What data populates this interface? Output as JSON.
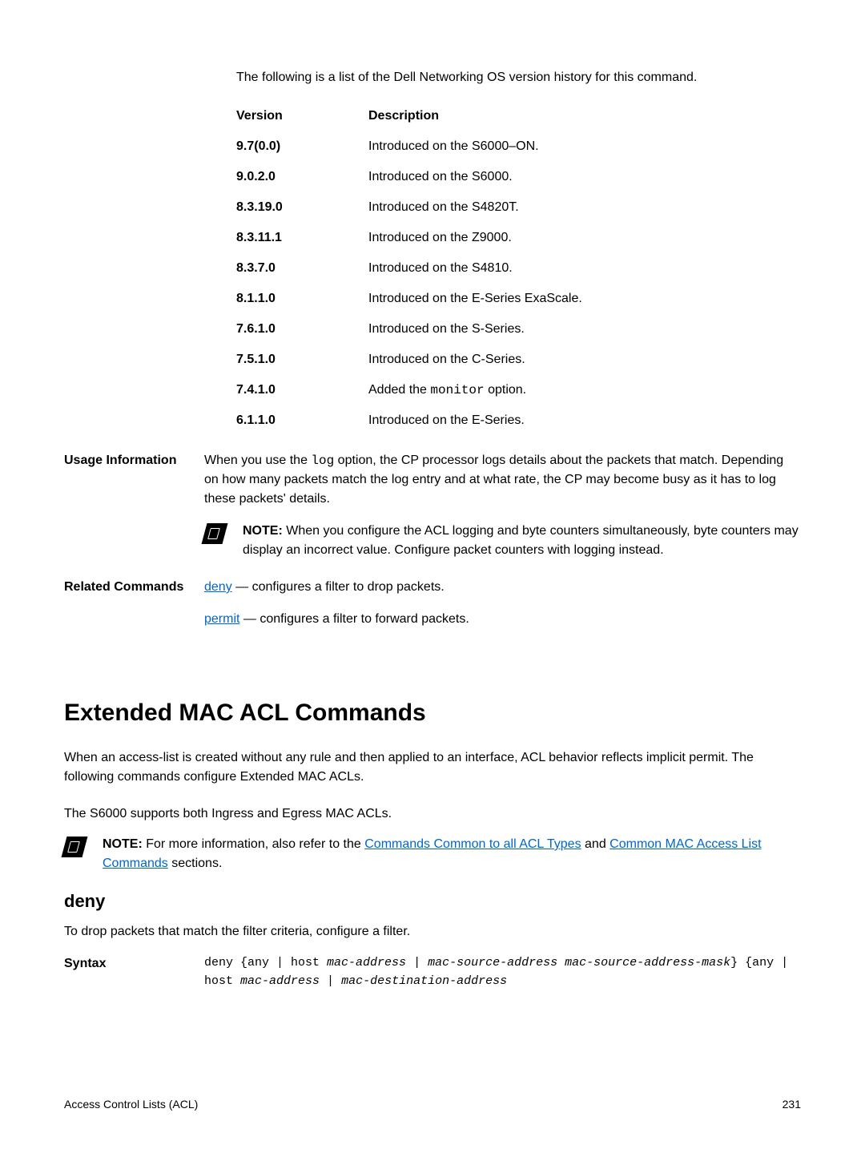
{
  "intro": "The following is a list of the Dell Networking OS version history for this command.",
  "headers": {
    "version": "Version",
    "description": "Description"
  },
  "versions": [
    {
      "v": "9.7(0.0)",
      "d": "Introduced on the S6000–ON."
    },
    {
      "v": "9.0.2.0",
      "d": "Introduced on the S6000."
    },
    {
      "v": "8.3.19.0",
      "d": "Introduced on the S4820T."
    },
    {
      "v": "8.3.11.1",
      "d": "Introduced on the Z9000."
    },
    {
      "v": "8.3.7.0",
      "d": "Introduced on the S4810."
    },
    {
      "v": "8.1.1.0",
      "d": "Introduced on the E-Series ExaScale."
    },
    {
      "v": "7.6.1.0",
      "d": "Introduced on the S-Series."
    },
    {
      "v": "7.5.1.0",
      "d": "Introduced on the C-Series."
    }
  ],
  "version_monitor": {
    "v": "7.4.1.0",
    "d_pre": "Added the ",
    "d_mono": "monitor",
    "d_post": " option."
  },
  "version_last": {
    "v": "6.1.1.0",
    "d": "Introduced on the E-Series."
  },
  "usage": {
    "label": "Usage Information",
    "text_pre": "When you use the ",
    "text_mono": "log",
    "text_post": " option, the CP processor logs details about the packets that match. Depending on how many packets match the log entry and at what rate, the CP may become busy as it has to log these packets' details.",
    "note_label": "NOTE:",
    "note_text": " When you configure the ACL logging and byte counters simultaneously, byte counters may display an incorrect value. Configure packet counters with logging instead."
  },
  "related": {
    "label": "Related Commands",
    "deny_link": "deny",
    "deny_text": " — configures a filter to drop packets.",
    "permit_link": "permit",
    "permit_text": " — configures a filter to forward packets."
  },
  "h1": "Extended MAC ACL Commands",
  "h1_desc": "When an access-list is created without any rule and then applied to an interface, ACL behavior reflects implicit permit. The following commands configure Extended MAC ACLs.",
  "s6000": "The S6000 supports both Ingress and Egress MAC ACLs.",
  "note2": {
    "label": "NOTE:",
    "text_pre": " For more information, also refer to the ",
    "link1": "Commands Common to all ACL Types",
    "text_mid": " and ",
    "link2": "Common MAC Access List Commands",
    "text_post": " sections."
  },
  "h2": "deny",
  "deny_desc": "To drop packets that match the filter criteria, configure a filter.",
  "syntax": {
    "label": "Syntax",
    "p1": "deny {any | host ",
    "i1": "mac-address",
    "p2": " | ",
    "i2": "mac-source-address",
    "p3": " ",
    "i3": "mac-source-address-mask",
    "p4": "} {any | host ",
    "i4": "mac-address",
    "p5": " | ",
    "i5": "mac-destination-address"
  },
  "footer": {
    "left": "Access Control Lists (ACL)",
    "right": "231"
  }
}
